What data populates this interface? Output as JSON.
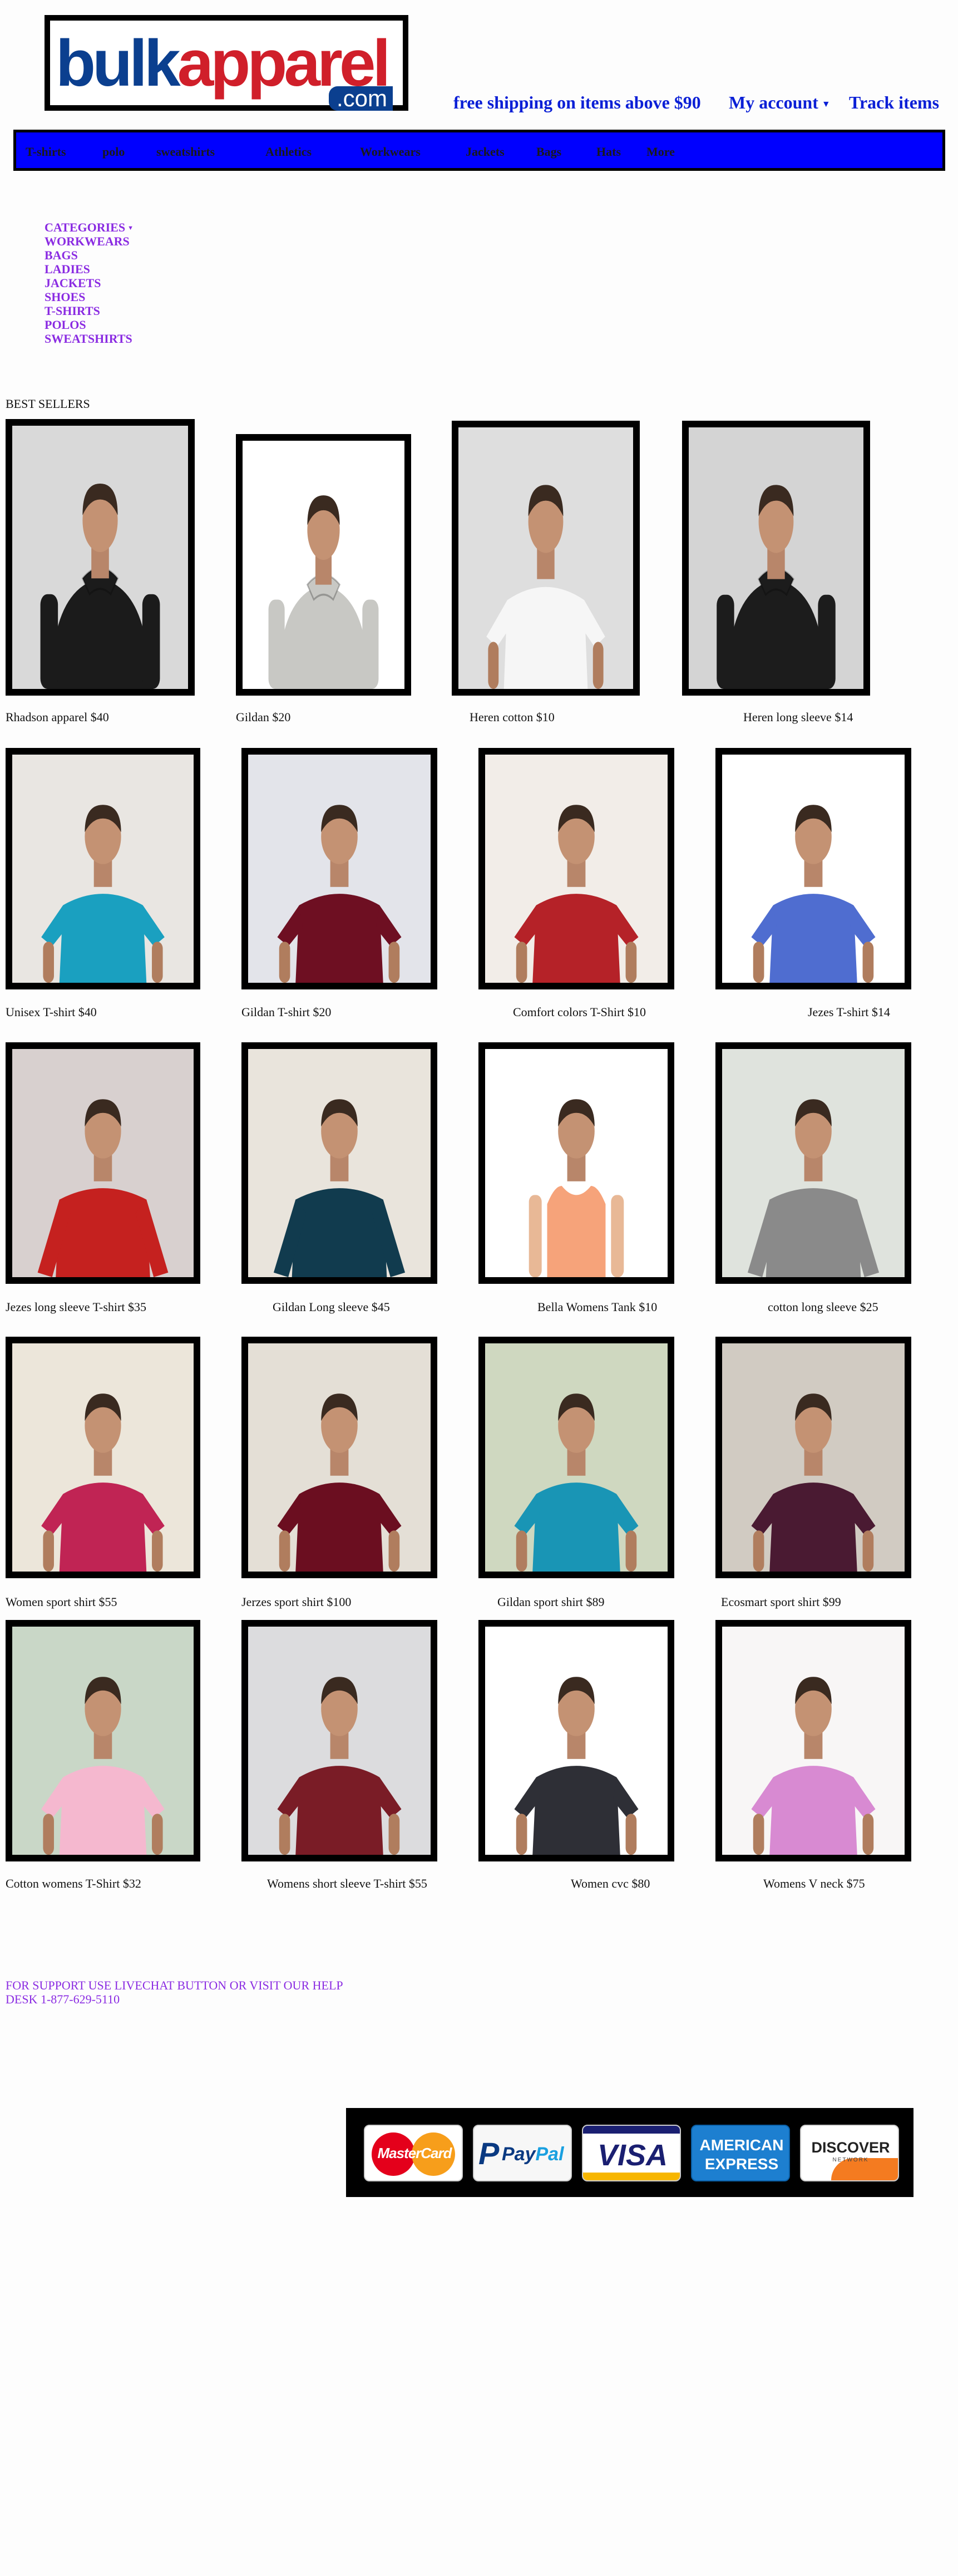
{
  "header": {
    "logo": {
      "part1": "bulk",
      "part2": "apparel",
      "dotcom": ".com"
    },
    "shipping_text": "free shipping on items above $90",
    "account_label": "My account",
    "track_label": "Track items"
  },
  "nav": {
    "items": [
      "T-shirts",
      "polo",
      "sweatshirts",
      "Athletics",
      "Workwears",
      "Jackets",
      "Bags",
      "Hats",
      "More"
    ]
  },
  "categories": {
    "heading": "CATEGORIES",
    "items": [
      "WORKWEARS",
      "BAGS",
      "LADIES",
      "JACKETS",
      "SHOES",
      "T-SHIRTS",
      "POLOS",
      "SWEATSHIRTS"
    ]
  },
  "best_sellers": {
    "title": "BEST SELLERS",
    "products": [
      {
        "caption": "Rhadson apparel $40",
        "color": "#1b1b1b",
        "bg": "#d9d9d9",
        "kind": "hoodie"
      },
      {
        "caption": "Gildan $20",
        "color": "#c8c8c4",
        "bg": "#ffffff",
        "kind": "hoodie"
      },
      {
        "caption": "Heren cotton $10",
        "color": "#f6f6f6",
        "bg": "#dedede",
        "kind": "tee"
      },
      {
        "caption": "Heren long sleeve $14",
        "color": "#1c1c1c",
        "bg": "#d4d4d4",
        "kind": "hoodie"
      },
      {
        "caption": "Unisex T-shirt $40",
        "color": "#1aa0c0",
        "bg": "#e9e6e2",
        "kind": "tee"
      },
      {
        "caption": "Gildan T-shirt $20",
        "color": "#6e0f22",
        "bg": "#e3e4ea",
        "kind": "tee"
      },
      {
        "caption": "Comfort colors T-Shirt $10",
        "color": "#b52228",
        "bg": "#f2ede8",
        "kind": "tee"
      },
      {
        "caption": "Jezes T-shirt $14",
        "color": "#4f6dd0",
        "bg": "#ffffff",
        "kind": "tee"
      },
      {
        "caption": "Jezes long sleeve T-shirt $35",
        "color": "#c5211f",
        "bg": "#d8d0cf",
        "kind": "long"
      },
      {
        "caption": "Gildan Long sleeve $45",
        "color": "#113b4e",
        "bg": "#e9e4dc",
        "kind": "long"
      },
      {
        "caption": "Bella Womens Tank $10",
        "color": "#f6a37a",
        "bg": "#ffffff",
        "kind": "tank"
      },
      {
        "caption": "cotton long sleeve $25",
        "color": "#8a8a8a",
        "bg": "#dfe3dd",
        "kind": "long"
      },
      {
        "caption": "Women sport shirt $55",
        "color": "#c02454",
        "bg": "#ece6da",
        "kind": "tee"
      },
      {
        "caption": "Jerzes sport shirt $100",
        "color": "#6b0e20",
        "bg": "#e4dfd6",
        "kind": "tee"
      },
      {
        "caption": "Gildan sport shirt $89",
        "color": "#1995b5",
        "bg": "#cfd8c0",
        "kind": "tee"
      },
      {
        "caption": "Ecosmart sport shirt $99",
        "color": "#4a1a32",
        "bg": "#d1cbc2",
        "kind": "tee"
      },
      {
        "caption": "Cotton womens T-Shirt $32",
        "color": "#f5b8cf",
        "bg": "#c9d7c7",
        "kind": "tee"
      },
      {
        "caption": "Womens short sleeve T-shirt $55",
        "color": "#7a1c26",
        "bg": "#dcdcde",
        "kind": "tee"
      },
      {
        "caption": "Women cvc $80",
        "color": "#2e2f36",
        "bg": "#ffffff",
        "kind": "tee"
      },
      {
        "caption": "Womens V neck $75",
        "color": "#d88ad2",
        "bg": "#f8f6f6",
        "kind": "tee"
      }
    ]
  },
  "support": {
    "text": "FOR SUPPORT USE LIVECHAT BUTTON OR VISIT OUR HELP DESK 1-877-629-5110"
  },
  "payments": {
    "mastercard": "MasterCard",
    "paypal_a": "Pay",
    "paypal_b": "Pal",
    "visa": "VISA",
    "amex_a": "AMERICAN",
    "amex_b": "EXPRESS",
    "discover": "DISCOVER",
    "discover_sub": "NETWORK"
  },
  "colors": {
    "accent": "#0000ff",
    "link": "#0a1fd6",
    "category": "#8a2be2"
  }
}
